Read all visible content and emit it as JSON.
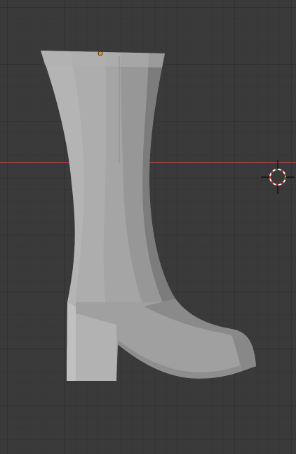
{
  "viewport": {
    "mode": "3d-viewport",
    "background_color": "#3a3a3a",
    "grid_color": "#333333",
    "x_axis_color": "#c04040"
  },
  "object": {
    "type": "mesh",
    "shape": "boot",
    "base_color": "#a8a8a8",
    "origin_color": "#e8902a"
  },
  "cursor_3d": {
    "icon": "crosshair-target-icon",
    "colors": [
      "#cc2222",
      "#ffffff",
      "#000000"
    ]
  }
}
